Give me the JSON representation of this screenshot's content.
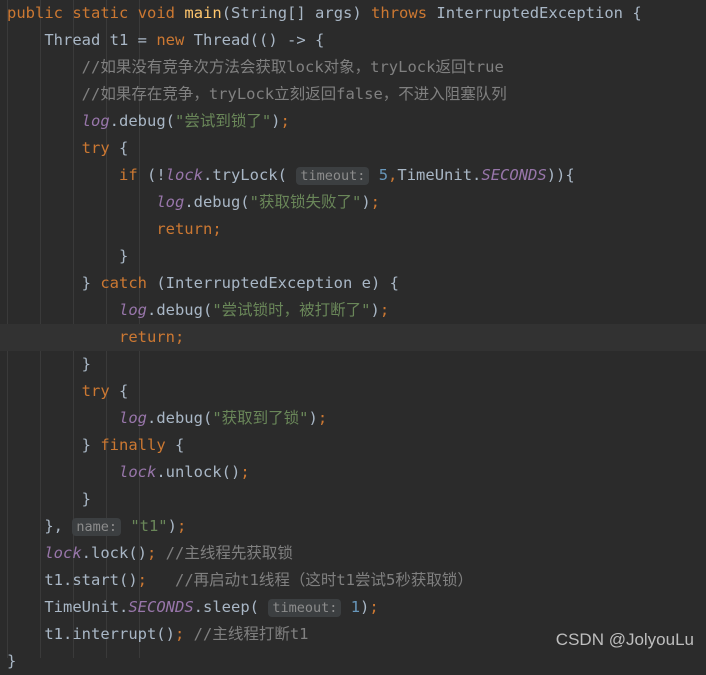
{
  "editor": {
    "theme_name": "darcula",
    "background": "#2B2B2B",
    "caret_line_background": "#323232",
    "watermark": "CSDN @JolyouLu",
    "colors": {
      "keyword": "#CC7832",
      "string": "#6A8759",
      "comment": "#808080",
      "number": "#6897BB",
      "field": "#9876AA",
      "method_declaration": "#FFC66D",
      "default_text": "#A9B7C6",
      "hint_background": "#3C3F41",
      "hint_text": "#8C8C8C"
    }
  },
  "code": {
    "language": "java",
    "lines": [
      {
        "indent": 0,
        "caret": false,
        "tokens": [
          {
            "t": "public",
            "c": "kw"
          },
          {
            "t": " ",
            "c": "pun"
          },
          {
            "t": "static",
            "c": "kw"
          },
          {
            "t": " ",
            "c": "pun"
          },
          {
            "t": "void",
            "c": "kw"
          },
          {
            "t": " ",
            "c": "pun"
          },
          {
            "t": "main",
            "c": "mth"
          },
          {
            "t": "(",
            "c": "pun"
          },
          {
            "t": "String",
            "c": "type"
          },
          {
            "t": "[] ",
            "c": "pun"
          },
          {
            "t": "args",
            "c": "type"
          },
          {
            "t": ") ",
            "c": "pun"
          },
          {
            "t": "throws",
            "c": "kw"
          },
          {
            "t": " ",
            "c": "pun"
          },
          {
            "t": "InterruptedException",
            "c": "type"
          },
          {
            "t": " {",
            "c": "pun"
          }
        ]
      },
      {
        "indent": 1,
        "caret": false,
        "tokens": [
          {
            "t": "Thread",
            "c": "type"
          },
          {
            "t": " t1 = ",
            "c": "pun"
          },
          {
            "t": "new",
            "c": "kw"
          },
          {
            "t": " ",
            "c": "pun"
          },
          {
            "t": "Thread",
            "c": "type"
          },
          {
            "t": "(() -> {",
            "c": "pun"
          }
        ]
      },
      {
        "indent": 2,
        "caret": false,
        "tokens": [
          {
            "t": "//如果没有竞争次方法会获取lock对象，tryLock返回true",
            "c": "cmt"
          }
        ]
      },
      {
        "indent": 2,
        "caret": false,
        "tokens": [
          {
            "t": "//如果存在竞争，tryLock立刻返回false，不进入阻塞队列",
            "c": "cmt"
          }
        ]
      },
      {
        "indent": 2,
        "caret": false,
        "tokens": [
          {
            "t": "log",
            "c": "fld"
          },
          {
            "t": ".debug(",
            "c": "pun"
          },
          {
            "t": "\"尝试到锁了\"",
            "c": "str"
          },
          {
            "t": ")",
            "c": "pun"
          },
          {
            "t": ";",
            "c": "semi"
          }
        ]
      },
      {
        "indent": 2,
        "caret": false,
        "tokens": [
          {
            "t": "try",
            "c": "kw"
          },
          {
            "t": " {",
            "c": "pun"
          }
        ]
      },
      {
        "indent": 3,
        "caret": false,
        "tokens": [
          {
            "t": "if",
            "c": "kw"
          },
          {
            "t": " (!",
            "c": "pun"
          },
          {
            "t": "lock",
            "c": "fld"
          },
          {
            "t": ".tryLock(",
            "c": "pun"
          },
          {
            "t": " ",
            "c": "pun"
          },
          {
            "t": "timeout:",
            "c": "hint"
          },
          {
            "t": " ",
            "c": "pun"
          },
          {
            "t": "5",
            "c": "num"
          },
          {
            "t": ",",
            "c": "semi"
          },
          {
            "t": "TimeUnit",
            "c": "type"
          },
          {
            "t": ".",
            "c": "pun"
          },
          {
            "t": "SECONDS",
            "c": "cnst"
          },
          {
            "t": ")){",
            "c": "pun"
          }
        ]
      },
      {
        "indent": 4,
        "caret": false,
        "tokens": [
          {
            "t": "log",
            "c": "fld"
          },
          {
            "t": ".debug(",
            "c": "pun"
          },
          {
            "t": "\"获取锁失败了\"",
            "c": "str"
          },
          {
            "t": ")",
            "c": "pun"
          },
          {
            "t": ";",
            "c": "semi"
          }
        ]
      },
      {
        "indent": 4,
        "caret": false,
        "tokens": [
          {
            "t": "return",
            "c": "kw"
          },
          {
            "t": ";",
            "c": "semi"
          }
        ]
      },
      {
        "indent": 3,
        "caret": false,
        "tokens": [
          {
            "t": "}",
            "c": "pun"
          }
        ]
      },
      {
        "indent": 2,
        "caret": false,
        "tokens": [
          {
            "t": "} ",
            "c": "pun"
          },
          {
            "t": "catch",
            "c": "kw"
          },
          {
            "t": " (",
            "c": "pun"
          },
          {
            "t": "InterruptedException",
            "c": "type"
          },
          {
            "t": " e) {",
            "c": "pun"
          }
        ]
      },
      {
        "indent": 3,
        "caret": false,
        "tokens": [
          {
            "t": "log",
            "c": "fld"
          },
          {
            "t": ".debug(",
            "c": "pun"
          },
          {
            "t": "\"尝试锁时，被打断了\"",
            "c": "str"
          },
          {
            "t": ")",
            "c": "pun"
          },
          {
            "t": ";",
            "c": "semi"
          }
        ]
      },
      {
        "indent": 3,
        "caret": true,
        "tokens": [
          {
            "t": "return",
            "c": "kw"
          },
          {
            "t": ";",
            "c": "semi"
          }
        ]
      },
      {
        "indent": 2,
        "caret": false,
        "tokens": [
          {
            "t": "}",
            "c": "pun"
          }
        ]
      },
      {
        "indent": 2,
        "caret": false,
        "tokens": [
          {
            "t": "try",
            "c": "kw"
          },
          {
            "t": " {",
            "c": "pun"
          }
        ]
      },
      {
        "indent": 3,
        "caret": false,
        "tokens": [
          {
            "t": "log",
            "c": "fld"
          },
          {
            "t": ".debug(",
            "c": "pun"
          },
          {
            "t": "\"获取到了锁\"",
            "c": "str"
          },
          {
            "t": ")",
            "c": "pun"
          },
          {
            "t": ";",
            "c": "semi"
          }
        ]
      },
      {
        "indent": 2,
        "caret": false,
        "tokens": [
          {
            "t": "} ",
            "c": "pun"
          },
          {
            "t": "finally",
            "c": "kw"
          },
          {
            "t": " {",
            "c": "pun"
          }
        ]
      },
      {
        "indent": 3,
        "caret": false,
        "tokens": [
          {
            "t": "lock",
            "c": "fld"
          },
          {
            "t": ".unlock()",
            "c": "pun"
          },
          {
            "t": ";",
            "c": "semi"
          }
        ]
      },
      {
        "indent": 2,
        "caret": false,
        "tokens": [
          {
            "t": "}",
            "c": "pun"
          }
        ]
      },
      {
        "indent": 1,
        "caret": false,
        "tokens": [
          {
            "t": "}, ",
            "c": "pun"
          },
          {
            "t": "name:",
            "c": "hint"
          },
          {
            "t": " ",
            "c": "pun"
          },
          {
            "t": "\"t1\"",
            "c": "str"
          },
          {
            "t": ")",
            "c": "pun"
          },
          {
            "t": ";",
            "c": "semi"
          }
        ]
      },
      {
        "indent": 1,
        "caret": false,
        "tokens": [
          {
            "t": "lock",
            "c": "fld"
          },
          {
            "t": ".lock()",
            "c": "pun"
          },
          {
            "t": ";",
            "c": "semi"
          },
          {
            "t": " ",
            "c": "pun"
          },
          {
            "t": "//主线程先获取锁",
            "c": "cmt"
          }
        ]
      },
      {
        "indent": 1,
        "caret": false,
        "tokens": [
          {
            "t": "t1.start()",
            "c": "pun"
          },
          {
            "t": ";",
            "c": "semi"
          },
          {
            "t": "   ",
            "c": "pun"
          },
          {
            "t": "//再启动t1线程（这时t1尝试5秒获取锁）",
            "c": "cmt"
          }
        ]
      },
      {
        "indent": 1,
        "caret": false,
        "tokens": [
          {
            "t": "TimeUnit",
            "c": "type"
          },
          {
            "t": ".",
            "c": "pun"
          },
          {
            "t": "SECONDS",
            "c": "cnst"
          },
          {
            "t": ".sleep(",
            "c": "pun"
          },
          {
            "t": " ",
            "c": "pun"
          },
          {
            "t": "timeout:",
            "c": "hint"
          },
          {
            "t": " ",
            "c": "pun"
          },
          {
            "t": "1",
            "c": "num"
          },
          {
            "t": ")",
            "c": "pun"
          },
          {
            "t": ";",
            "c": "semi"
          }
        ]
      },
      {
        "indent": 1,
        "caret": false,
        "tokens": [
          {
            "t": "t1.interrupt()",
            "c": "pun"
          },
          {
            "t": ";",
            "c": "semi"
          },
          {
            "t": " ",
            "c": "pun"
          },
          {
            "t": "//主线程打断t1",
            "c": "cmt"
          }
        ]
      },
      {
        "indent": 0,
        "caret": false,
        "tokens": [
          {
            "t": "}",
            "c": "pun"
          }
        ]
      }
    ]
  },
  "indent_guides": [
    7,
    40,
    73,
    106,
    139
  ]
}
